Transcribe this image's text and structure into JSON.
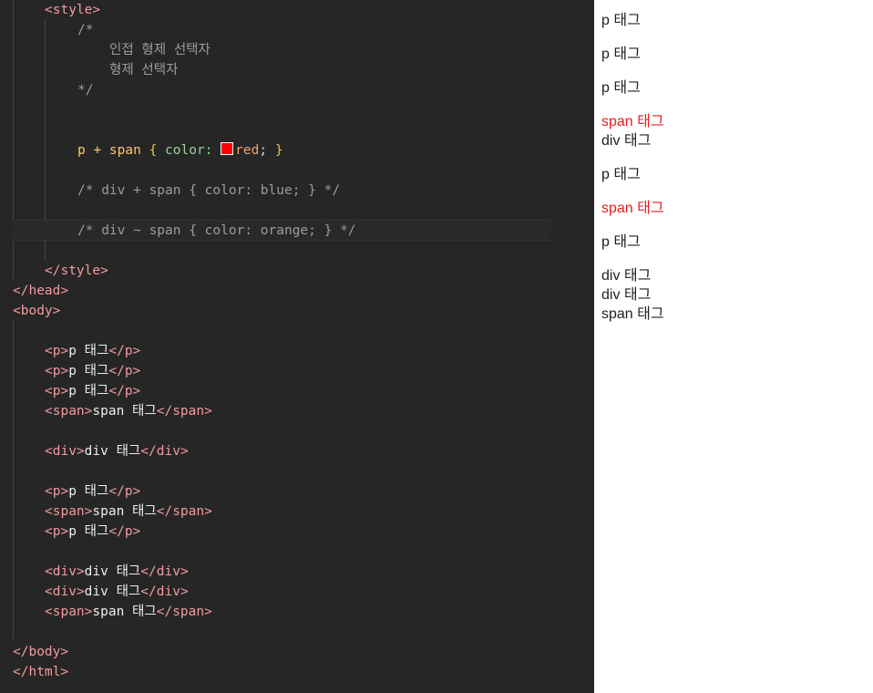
{
  "editor": {
    "style_open": "style",
    "comment_open": "/*",
    "comment_line1": "인접 형제 선택자",
    "comment_line2": "형제 선택자",
    "comment_close": "*/",
    "rule1": {
      "selector": "p + span",
      "open_brace": "{",
      "property": "color:",
      "value": "red",
      "semicolon": ";",
      "close_brace": "}",
      "swatch_color": "#ff0000"
    },
    "rule2_comment": "/* div + span { color: blue; } */",
    "rule3_comment": "/* div ~ span { color: orange; } */",
    "style_close": "style",
    "head_close": "head",
    "body_open": "body",
    "markup": [
      {
        "tag": "p",
        "text": "p 태그"
      },
      {
        "tag": "p",
        "text": "p 태그"
      },
      {
        "tag": "p",
        "text": "p 태그"
      },
      {
        "tag": "span",
        "text": "span 태그"
      },
      {
        "tag": "div",
        "text": "div 태그"
      },
      {
        "tag": "p",
        "text": "p 태그"
      },
      {
        "tag": "span",
        "text": "span 태그"
      },
      {
        "tag": "p",
        "text": "p 태그"
      },
      {
        "tag": "div",
        "text": "div 태그"
      },
      {
        "tag": "div",
        "text": "div 태그"
      },
      {
        "tag": "span",
        "text": "span 태그"
      }
    ],
    "body_close": "body",
    "html_close": "html"
  },
  "preview": {
    "accent_red": "#e02020",
    "lines": [
      "p 태그",
      "p 태그",
      "p 태그",
      "span 태그",
      "div 태그",
      "p 태그",
      "span 태그",
      "p 태그",
      "div 태그",
      "div 태그",
      "span 태그"
    ]
  }
}
